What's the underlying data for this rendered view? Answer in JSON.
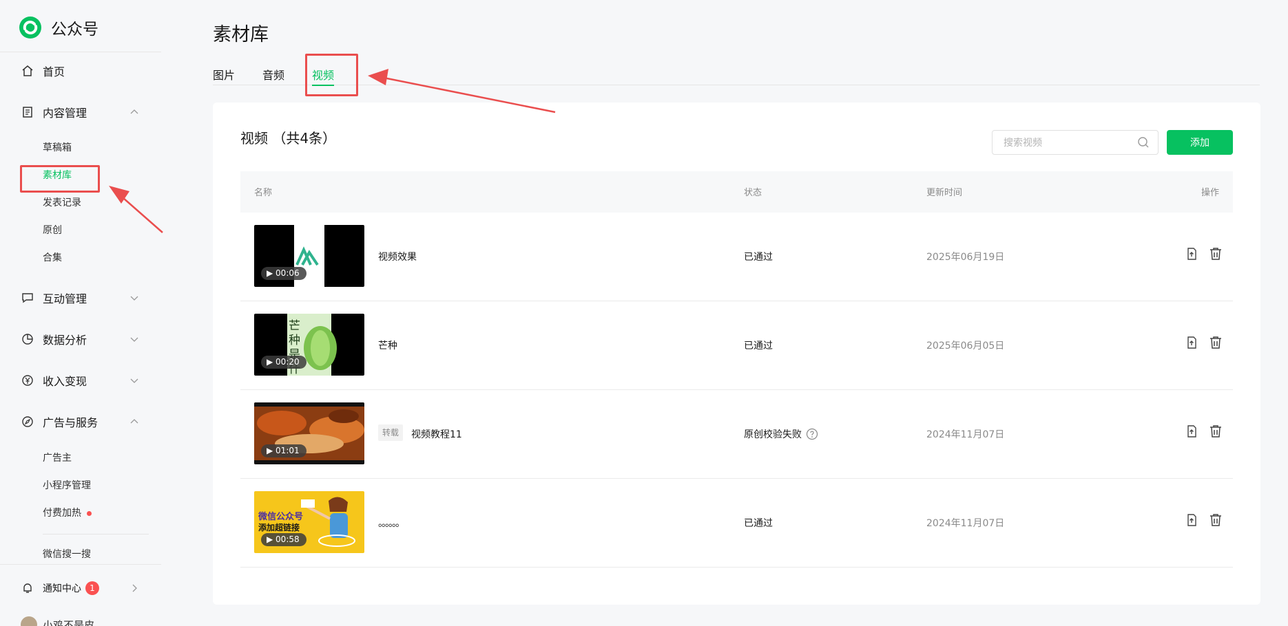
{
  "brand": {
    "name": "公众号",
    "color": "#07c160"
  },
  "sidebar": {
    "home": "首页",
    "content_mgmt": {
      "label": "内容管理",
      "items": [
        "草稿箱",
        "素材库",
        "发表记录",
        "原创",
        "合集"
      ],
      "active": "素材库"
    },
    "interaction": "互动管理",
    "analytics": "数据分析",
    "monetize": "收入变现",
    "ads": {
      "label": "广告与服务",
      "items": [
        "广告主",
        "小程序管理",
        "付费加热"
      ]
    },
    "wechat_search": "微信搜一搜",
    "notify": {
      "label": "通知中心",
      "count": "1"
    },
    "user": {
      "name": "小鸡不是皮"
    }
  },
  "page": {
    "title": "素材库"
  },
  "tabs": [
    "图片",
    "音频",
    "视频"
  ],
  "active_tab": "视频",
  "list": {
    "title": "视频 （共4条）",
    "search_placeholder": "搜索视频",
    "add_label": "添加",
    "columns": {
      "name": "名称",
      "status": "状态",
      "updated": "更新时间",
      "ops": "操作"
    },
    "rows": [
      {
        "name": "视频效果",
        "duration": "▶ 00:06",
        "status": "已通过",
        "updated": "2025年06月19日",
        "tag": ""
      },
      {
        "name": "芒种",
        "duration": "▶ 00:20",
        "status": "已通过",
        "updated": "2025年06月05日",
        "tag": ""
      },
      {
        "name": "视频教程11",
        "duration": "▶ 01:01",
        "status": "原创校验失败",
        "updated": "2024年11月07日",
        "tag": "转载"
      },
      {
        "name": "。。。。。。",
        "duration": "▶ 00:58",
        "status": "已通过",
        "updated": "2024年11月07日",
        "tag": ""
      }
    ]
  },
  "thumb_text": {
    "row2": "芒种是什么",
    "row4_line1": "微信公众号",
    "row4_line2": "添加超链接"
  }
}
